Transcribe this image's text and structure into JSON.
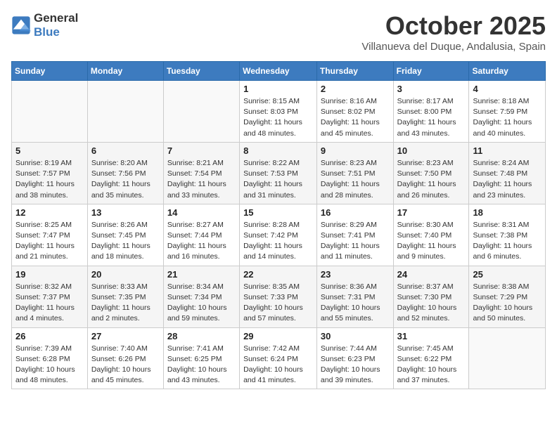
{
  "logo": {
    "text_general": "General",
    "text_blue": "Blue"
  },
  "title": "October 2025",
  "subtitle": "Villanueva del Duque, Andalusia, Spain",
  "days_of_week": [
    "Sunday",
    "Monday",
    "Tuesday",
    "Wednesday",
    "Thursday",
    "Friday",
    "Saturday"
  ],
  "weeks": [
    [
      {
        "day": "",
        "info": ""
      },
      {
        "day": "",
        "info": ""
      },
      {
        "day": "",
        "info": ""
      },
      {
        "day": "1",
        "info": "Sunrise: 8:15 AM\nSunset: 8:03 PM\nDaylight: 11 hours and 48 minutes."
      },
      {
        "day": "2",
        "info": "Sunrise: 8:16 AM\nSunset: 8:02 PM\nDaylight: 11 hours and 45 minutes."
      },
      {
        "day": "3",
        "info": "Sunrise: 8:17 AM\nSunset: 8:00 PM\nDaylight: 11 hours and 43 minutes."
      },
      {
        "day": "4",
        "info": "Sunrise: 8:18 AM\nSunset: 7:59 PM\nDaylight: 11 hours and 40 minutes."
      }
    ],
    [
      {
        "day": "5",
        "info": "Sunrise: 8:19 AM\nSunset: 7:57 PM\nDaylight: 11 hours and 38 minutes."
      },
      {
        "day": "6",
        "info": "Sunrise: 8:20 AM\nSunset: 7:56 PM\nDaylight: 11 hours and 35 minutes."
      },
      {
        "day": "7",
        "info": "Sunrise: 8:21 AM\nSunset: 7:54 PM\nDaylight: 11 hours and 33 minutes."
      },
      {
        "day": "8",
        "info": "Sunrise: 8:22 AM\nSunset: 7:53 PM\nDaylight: 11 hours and 31 minutes."
      },
      {
        "day": "9",
        "info": "Sunrise: 8:23 AM\nSunset: 7:51 PM\nDaylight: 11 hours and 28 minutes."
      },
      {
        "day": "10",
        "info": "Sunrise: 8:23 AM\nSunset: 7:50 PM\nDaylight: 11 hours and 26 minutes."
      },
      {
        "day": "11",
        "info": "Sunrise: 8:24 AM\nSunset: 7:48 PM\nDaylight: 11 hours and 23 minutes."
      }
    ],
    [
      {
        "day": "12",
        "info": "Sunrise: 8:25 AM\nSunset: 7:47 PM\nDaylight: 11 hours and 21 minutes."
      },
      {
        "day": "13",
        "info": "Sunrise: 8:26 AM\nSunset: 7:45 PM\nDaylight: 11 hours and 18 minutes."
      },
      {
        "day": "14",
        "info": "Sunrise: 8:27 AM\nSunset: 7:44 PM\nDaylight: 11 hours and 16 minutes."
      },
      {
        "day": "15",
        "info": "Sunrise: 8:28 AM\nSunset: 7:42 PM\nDaylight: 11 hours and 14 minutes."
      },
      {
        "day": "16",
        "info": "Sunrise: 8:29 AM\nSunset: 7:41 PM\nDaylight: 11 hours and 11 minutes."
      },
      {
        "day": "17",
        "info": "Sunrise: 8:30 AM\nSunset: 7:40 PM\nDaylight: 11 hours and 9 minutes."
      },
      {
        "day": "18",
        "info": "Sunrise: 8:31 AM\nSunset: 7:38 PM\nDaylight: 11 hours and 6 minutes."
      }
    ],
    [
      {
        "day": "19",
        "info": "Sunrise: 8:32 AM\nSunset: 7:37 PM\nDaylight: 11 hours and 4 minutes."
      },
      {
        "day": "20",
        "info": "Sunrise: 8:33 AM\nSunset: 7:35 PM\nDaylight: 11 hours and 2 minutes."
      },
      {
        "day": "21",
        "info": "Sunrise: 8:34 AM\nSunset: 7:34 PM\nDaylight: 10 hours and 59 minutes."
      },
      {
        "day": "22",
        "info": "Sunrise: 8:35 AM\nSunset: 7:33 PM\nDaylight: 10 hours and 57 minutes."
      },
      {
        "day": "23",
        "info": "Sunrise: 8:36 AM\nSunset: 7:31 PM\nDaylight: 10 hours and 55 minutes."
      },
      {
        "day": "24",
        "info": "Sunrise: 8:37 AM\nSunset: 7:30 PM\nDaylight: 10 hours and 52 minutes."
      },
      {
        "day": "25",
        "info": "Sunrise: 8:38 AM\nSunset: 7:29 PM\nDaylight: 10 hours and 50 minutes."
      }
    ],
    [
      {
        "day": "26",
        "info": "Sunrise: 7:39 AM\nSunset: 6:28 PM\nDaylight: 10 hours and 48 minutes."
      },
      {
        "day": "27",
        "info": "Sunrise: 7:40 AM\nSunset: 6:26 PM\nDaylight: 10 hours and 45 minutes."
      },
      {
        "day": "28",
        "info": "Sunrise: 7:41 AM\nSunset: 6:25 PM\nDaylight: 10 hours and 43 minutes."
      },
      {
        "day": "29",
        "info": "Sunrise: 7:42 AM\nSunset: 6:24 PM\nDaylight: 10 hours and 41 minutes."
      },
      {
        "day": "30",
        "info": "Sunrise: 7:44 AM\nSunset: 6:23 PM\nDaylight: 10 hours and 39 minutes."
      },
      {
        "day": "31",
        "info": "Sunrise: 7:45 AM\nSunset: 6:22 PM\nDaylight: 10 hours and 37 minutes."
      },
      {
        "day": "",
        "info": ""
      }
    ]
  ]
}
